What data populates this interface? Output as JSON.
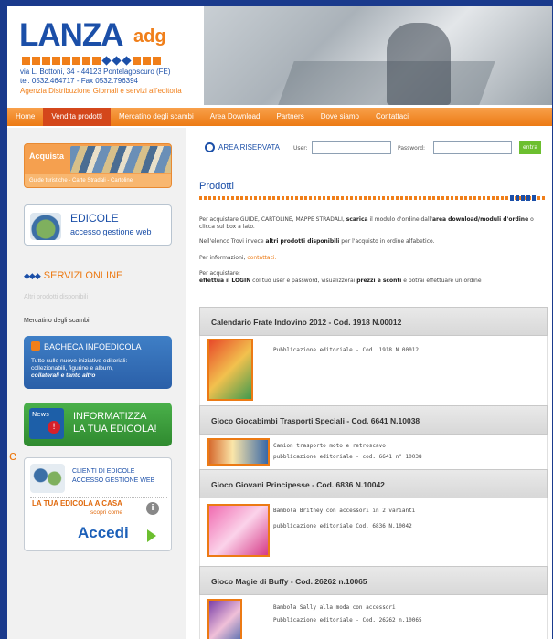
{
  "header": {
    "logo_main": "LANZA",
    "logo_sub": "adg",
    "address": "via L. Bottoni, 34 - 44123 Pontelagoscuro (FE)",
    "phone": "tel. 0532.464717 - Fax 0532.796394",
    "tagline": "Agenzia Distribuzione Giornali e servizi all'editoria"
  },
  "nav": {
    "items": [
      "Home",
      "Vendita prodotti",
      "Mercatino degli scambi",
      "Area Download",
      "Partners",
      "Dove siamo",
      "Contattaci"
    ],
    "active": "Vendita prodotti"
  },
  "sidebar": {
    "acquista_title": "Acquista",
    "acquista_subtitle": "Guide turistiche - Carte Stradali - Cartoline",
    "edicole_title": "EDICOLE",
    "edicole_subtitle": "accesso gestione web",
    "servizi_title": "SERVIZI ONLINE",
    "link_altri": "Altri prodotti disponibili",
    "link_mercatino": "Mercatino degli scambi",
    "bacheca_title": "BACHECA INFOEDICOLA",
    "bacheca_text_1": "Tutto sulle nuove iniziative editoriali:",
    "bacheca_text_2": "collezionabili, figurine e album,",
    "bacheca_text_3": "collaterali e tanto altro",
    "info_line1": "INFORMATIZZA",
    "info_line2": "LA TUA EDICOLA!",
    "clienti_line1": "CLIENTI DI EDICOLE",
    "clienti_line2": "ACCESSO GESTIONE WEB",
    "casa_title": "LA TUA EDICOLA A CASA",
    "casa_link": "scopri come",
    "accedi": "Accedi"
  },
  "login": {
    "label": "AREA RISERVATA",
    "user_label": "User:",
    "password_label": "Password:",
    "submit_label": "entra"
  },
  "main": {
    "title": "Prodotti",
    "intro_1a": "Per acquistare GUIDE, CARTOLINE, MAPPE STRADALI,",
    "intro_1b": "scarica",
    "intro_1c": "il modulo d'ordine dall'",
    "intro_1d": "area download/moduli d'ordine",
    "intro_1e": "o clicca sul box a lato.",
    "intro_2a": "Nell'elenco Trovi invece",
    "intro_2b": "altri prodotti disponibili",
    "intro_2c": "per l'acquisto in ordine alfabetico.",
    "intro_3a": "Per informazioni,",
    "intro_3b": "contattaci.",
    "intro_4a": "Per acquistare:",
    "intro_4b": "effettua il LOGIN",
    "intro_4c": "col tuo user e password, visualizzerai",
    "intro_4d": "prezzi e sconti",
    "intro_4e": "e potrai effettuare un ordine"
  },
  "products": [
    {
      "title": "Calendario Frate Indovino 2012 - Cod. 1918 N.00012",
      "desc_1": "Pubblicazione editoriale - Cod. 1918 N.00012",
      "desc_2": ""
    },
    {
      "title": "Gioco Giocabimbi Trasporti Speciali - Cod. 6641 N.10038",
      "desc_1": "Camion trasporto moto e retroscavo",
      "desc_2": "pubblicazione editoriale - cod. 6641  n° 10038"
    },
    {
      "title": "Gioco Giovani Principesse - Cod. 6836 N.10042",
      "desc_1": "Bambola Britney con accessori in 2 varianti",
      "desc_2": "pubblicazione editoriale Cod. 6836 N.10042"
    },
    {
      "title": "Gioco Magie di Buffy - Cod. 26262 n.10065",
      "desc_1": "Bambola Sally alla moda con accessori",
      "desc_2": "Pubblicazione editoriale - Cod. 26262 n.10065"
    }
  ],
  "stray_text": "e"
}
